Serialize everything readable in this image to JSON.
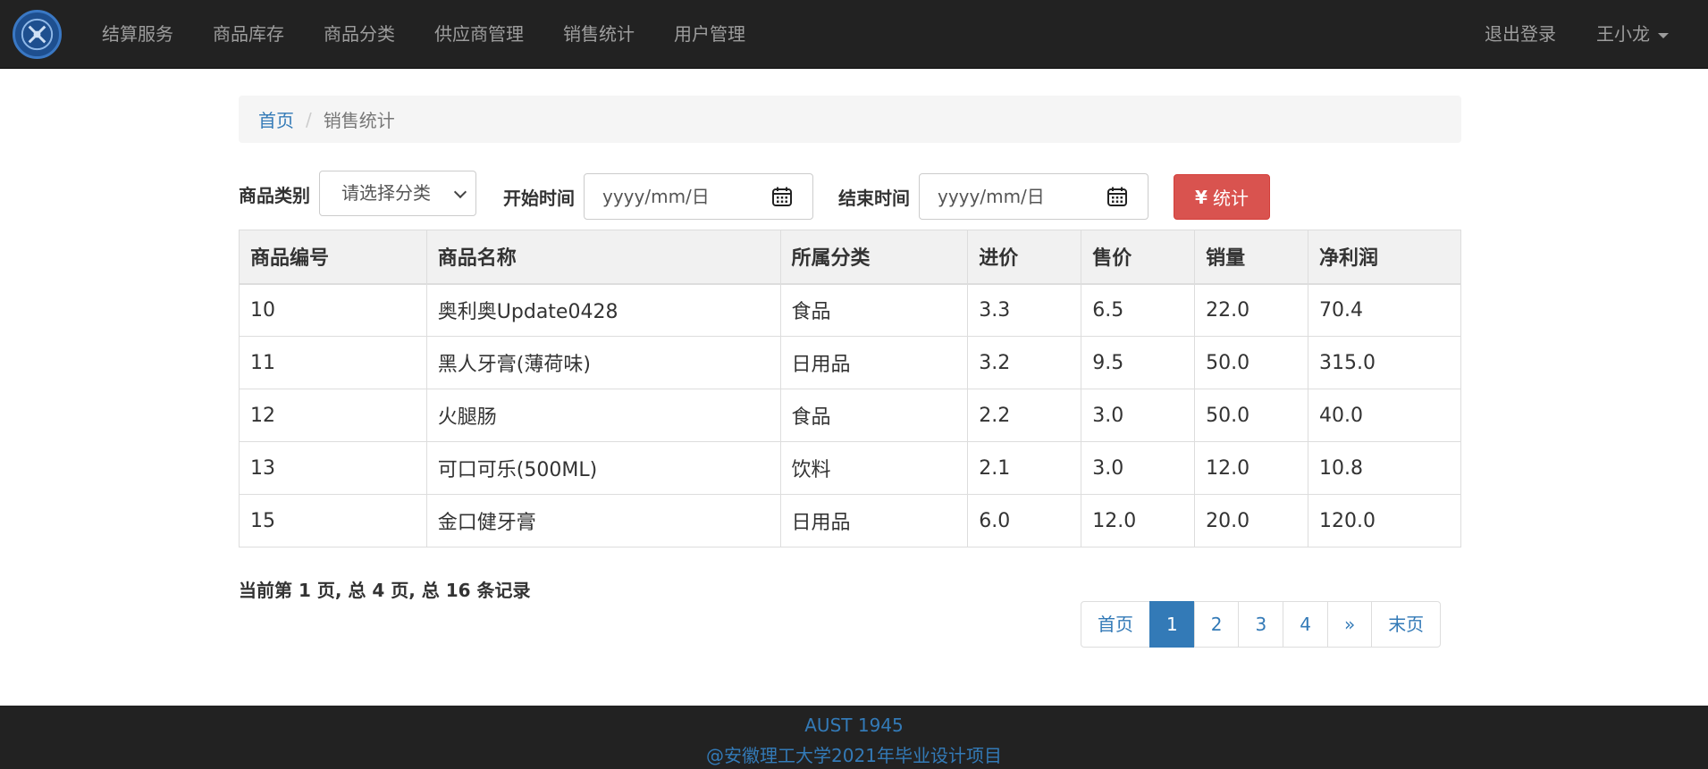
{
  "nav": {
    "items": [
      "结算服务",
      "商品库存",
      "商品分类",
      "供应商管理",
      "销售统计",
      "用户管理"
    ],
    "logout": "退出登录",
    "user": "王小龙"
  },
  "breadcrumb": {
    "home": "首页",
    "separator": "/",
    "current": "销售统计"
  },
  "filters": {
    "category_label": "商品类别",
    "category_value": "请选择分类",
    "start_label": "开始时间",
    "start_placeholder": "yyyy/mm/日",
    "end_label": "结束时间",
    "end_placeholder": "yyyy/mm/日",
    "submit_label": "统计",
    "submit_icon": "¥"
  },
  "table": {
    "headers": [
      "商品编号",
      "商品名称",
      "所属分类",
      "进价",
      "售价",
      "销量",
      "净利润"
    ],
    "rows": [
      [
        "10",
        "奥利奥Update0428",
        "食品",
        "3.3",
        "6.5",
        "22.0",
        "70.4"
      ],
      [
        "11",
        "黑人牙膏(薄荷味)",
        "日用品",
        "3.2",
        "9.5",
        "50.0",
        "315.0"
      ],
      [
        "12",
        "火腿肠",
        "食品",
        "2.2",
        "3.0",
        "50.0",
        "40.0"
      ],
      [
        "13",
        "可口可乐(500ML)",
        "饮料",
        "2.1",
        "3.0",
        "12.0",
        "10.8"
      ],
      [
        "15",
        "金口健牙膏",
        "日用品",
        "6.0",
        "12.0",
        "20.0",
        "120.0"
      ]
    ]
  },
  "page_info": "当前第 1 页, 总 4 页, 总 16 条记录",
  "pagination": [
    "首页",
    "1",
    "2",
    "3",
    "4",
    "»",
    "末页"
  ],
  "pagination_active": "1",
  "footer": {
    "line1": "AUST 1945",
    "line2": "@安徽理工大学2021年毕业设计项目"
  },
  "colors": {
    "navbar": "#222222",
    "link": "#337ab7",
    "danger": "#d9534f"
  },
  "icons": {
    "logo": "university-logo-icon",
    "caret": "caret-down-icon",
    "calendar": "calendar-icon",
    "select": "chevron-down-icon",
    "yen": "yen-icon"
  }
}
